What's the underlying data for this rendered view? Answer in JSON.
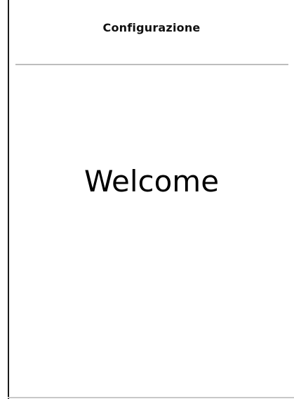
{
  "header": {
    "title": "Configurazione"
  },
  "main": {
    "welcome_text": "Welcome"
  },
  "colors": {
    "background": "#ffffff",
    "divider": "#bdbdbd",
    "text": "#000000"
  }
}
